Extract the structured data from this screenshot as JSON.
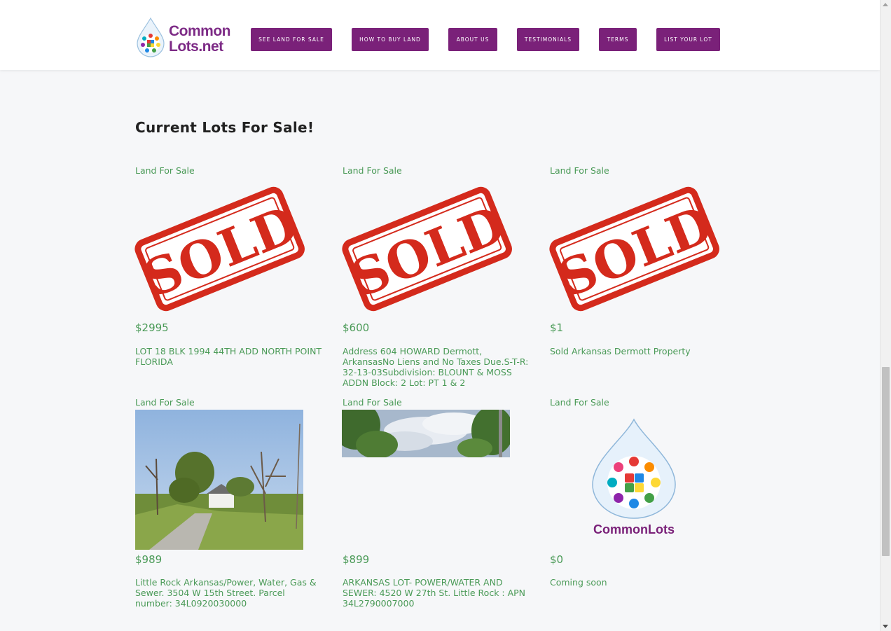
{
  "header": {
    "logo_line1": "Common",
    "logo_line2": "Lots.net",
    "nav": [
      "SEE LAND FOR SALE",
      "HOW TO BUY LAND",
      "ABOUT US",
      "TESTIMONIALS",
      "TERMS",
      "LIST YOUR LOT"
    ]
  },
  "main": {
    "title": "Current Lots For Sale!",
    "listings": [
      {
        "label": "Land For Sale",
        "image": "sold-stamp",
        "price": "$2995",
        "description": "LOT 18 BLK 1994 44TH ADD NORTH POINT FLORIDA"
      },
      {
        "label": "Land For Sale",
        "image": "sold-stamp",
        "price": "$600",
        "description": "Address 604 HOWARD Dermott, ArkansasNo Liens and No Taxes Due.S-T-R: 32-13-03Subdivision: BLOUNT & MOSS ADDN Block: 2 Lot: PT 1 & 2"
      },
      {
        "label": "Land For Sale",
        "image": "sold-stamp",
        "price": "$1",
        "description": "Sold Arkansas Dermott Property"
      },
      {
        "label": "Land For Sale",
        "image": "street-photo",
        "price": "$989",
        "description": "Little Rock Arkansas/Power, Water, Gas & Sewer. 3504 W 15th Street. Parcel number: 34L0920030000"
      },
      {
        "label": "Land For Sale",
        "image": "trees-photo",
        "price": "$899",
        "description": "ARKANSAS LOT- POWER/WATER AND SEWER: 4520 W 27th St. Little Rock : APN 34L2790007000"
      },
      {
        "label": "Land For Sale",
        "image": "commonlots-logo",
        "price": "$0",
        "description": "Coming soon"
      }
    ],
    "sold_stamp_text": "SOLD",
    "placeholder_logo_text": "CommonLots"
  },
  "colors": {
    "brand_purple": "#7a2179",
    "text_green": "#4a9a57",
    "stamp_red": "#d42a1c"
  }
}
